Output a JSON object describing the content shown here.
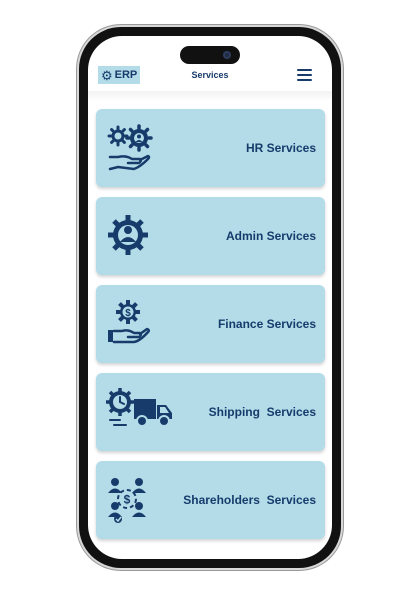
{
  "header": {
    "logo_text": "ERP",
    "title": "Services"
  },
  "services": [
    {
      "label": "HR Services",
      "icon": "hr-gears-hand-icon"
    },
    {
      "label": "Admin Services",
      "icon": "admin-gear-person-icon"
    },
    {
      "label": "Finance Services",
      "icon": "finance-gear-hand-icon"
    },
    {
      "label": "Shipping  Services",
      "icon": "shipping-truck-clock-icon"
    },
    {
      "label": "Shareholders  Services",
      "icon": "shareholders-people-icon"
    }
  ],
  "colors": {
    "card_bg": "#b3dbe8",
    "primary_dark": "#173c6b",
    "phone_frame": "#111111"
  }
}
